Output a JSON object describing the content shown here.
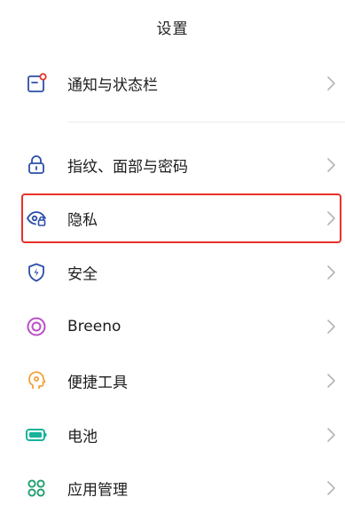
{
  "header": {
    "title": "设置"
  },
  "items": [
    {
      "id": "notifications",
      "label": "通知与状态栏",
      "icon": "notification-icon"
    },
    {
      "id": "fingerprint",
      "label": "指纹、面部与密码",
      "icon": "lock-icon"
    },
    {
      "id": "privacy",
      "label": "隐私",
      "icon": "privacy-eye-lock-icon"
    },
    {
      "id": "security",
      "label": "安全",
      "icon": "shield-bolt-icon"
    },
    {
      "id": "breeno",
      "label": "Breeno",
      "icon": "breeno-icon"
    },
    {
      "id": "tools",
      "label": "便捷工具",
      "icon": "head-tools-icon"
    },
    {
      "id": "battery",
      "label": "电池",
      "icon": "battery-icon"
    },
    {
      "id": "apps",
      "label": "应用管理",
      "icon": "apps-grid-icon"
    }
  ],
  "colors": {
    "icon_blue": "#2b4ea8",
    "notification_red": "#e8322b",
    "breeno_purple": "#b94fc8",
    "tools_orange": "#f2a33a",
    "battery_teal": "#17b39b",
    "apps_green": "#1f9e6d",
    "highlight_red": "#e8322b",
    "chevron_gray": "#b5b5b5"
  }
}
